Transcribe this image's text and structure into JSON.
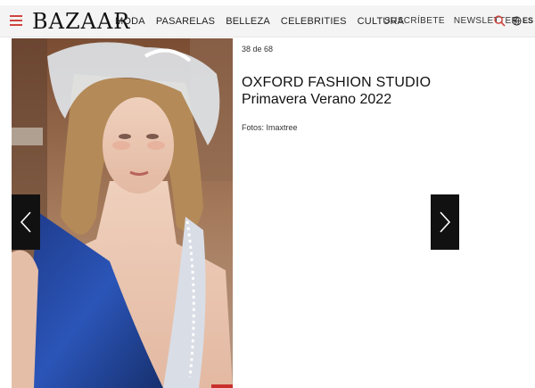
{
  "header": {
    "logo": "BAZAAR",
    "nav": [
      "MODA",
      "PASARELAS",
      "BELLEZA",
      "CELEBRITIES",
      "CULTURA"
    ],
    "subscribe": "SUSCRÍBETE",
    "newsletter": "NEWSLETTER",
    "language": "ES"
  },
  "gallery": {
    "counter": "38 de 68",
    "title": "OXFORD FASHION STUDIO",
    "subtitle": "Primavera Verano 2022",
    "credit": "Fotos: Imaxtree"
  },
  "colors": {
    "accent": "#d0453f",
    "arrow_bg": "#111111"
  },
  "icons": {
    "menu": "hamburger-icon",
    "search": "search-icon",
    "globe": "globe-icon",
    "prev": "chevron-left-icon",
    "next": "chevron-right-icon"
  }
}
